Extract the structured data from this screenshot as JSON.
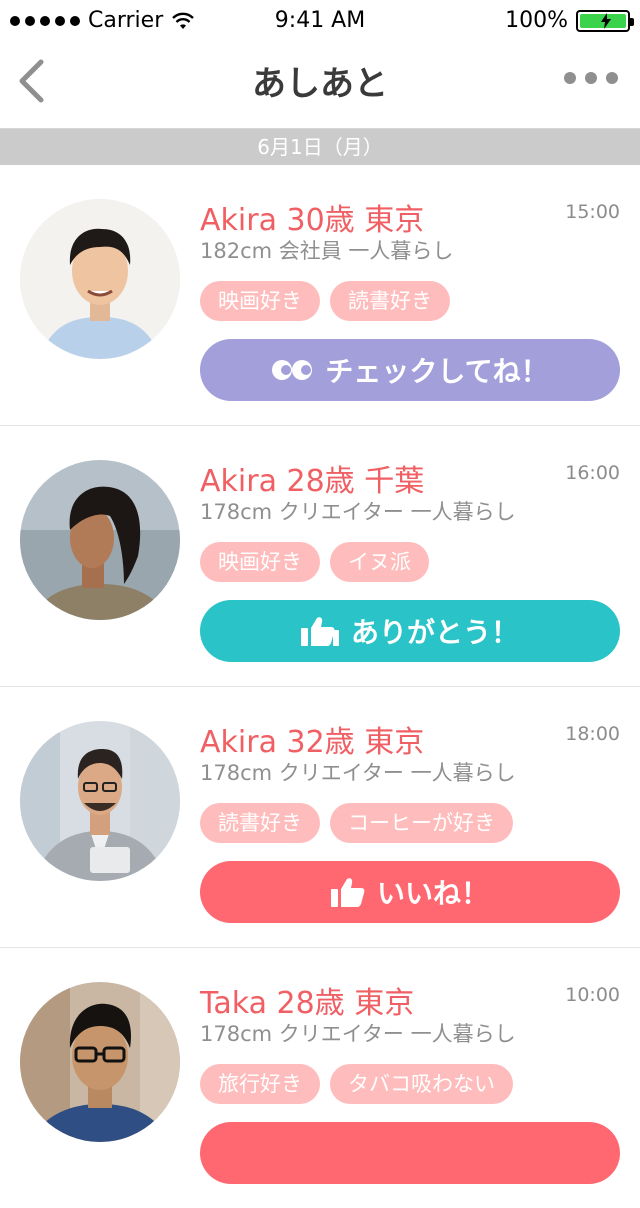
{
  "status": {
    "carrier": "Carrier",
    "time": "9:41 AM",
    "battery": "100%"
  },
  "nav": {
    "title": "あしあと",
    "back_icon": "chevron-left-icon",
    "more_icon": "more-dots-icon"
  },
  "date_header": "6月1日（月）",
  "colors": {
    "name": "#f05f63",
    "tag": "#ffbcbc",
    "check": "#a29fdb",
    "thanks": "#2ac3c7",
    "like": "#ff6771"
  },
  "items": [
    {
      "name": "Akira 30歳 東京",
      "time": "15:00",
      "meta": "182cm 会社員 一人暮らし",
      "tags": [
        "映画好き",
        "読書好き"
      ],
      "action": "チェックしてね！",
      "action_icon": "eyes-icon"
    },
    {
      "name": "Akira 28歳 千葉",
      "time": "16:00",
      "meta": "178cm クリエイター 一人暮らし",
      "tags": [
        "映画好き",
        "イヌ派"
      ],
      "action": "ありがとう！",
      "action_icon": "thumbs-up-icon"
    },
    {
      "name": "Akira 32歳 東京",
      "time": "18:00",
      "meta": "178cm クリエイター 一人暮らし",
      "tags": [
        "読書好き",
        "コーヒーが好き"
      ],
      "action": "いいね！",
      "action_icon": "thumbs-up-icon"
    },
    {
      "name": "Taka 28歳 東京",
      "time": "10:00",
      "meta": "178cm クリエイター 一人暮らし",
      "tags": [
        "旅行好き",
        "タバコ吸わない"
      ],
      "action": "",
      "action_icon": ""
    }
  ]
}
